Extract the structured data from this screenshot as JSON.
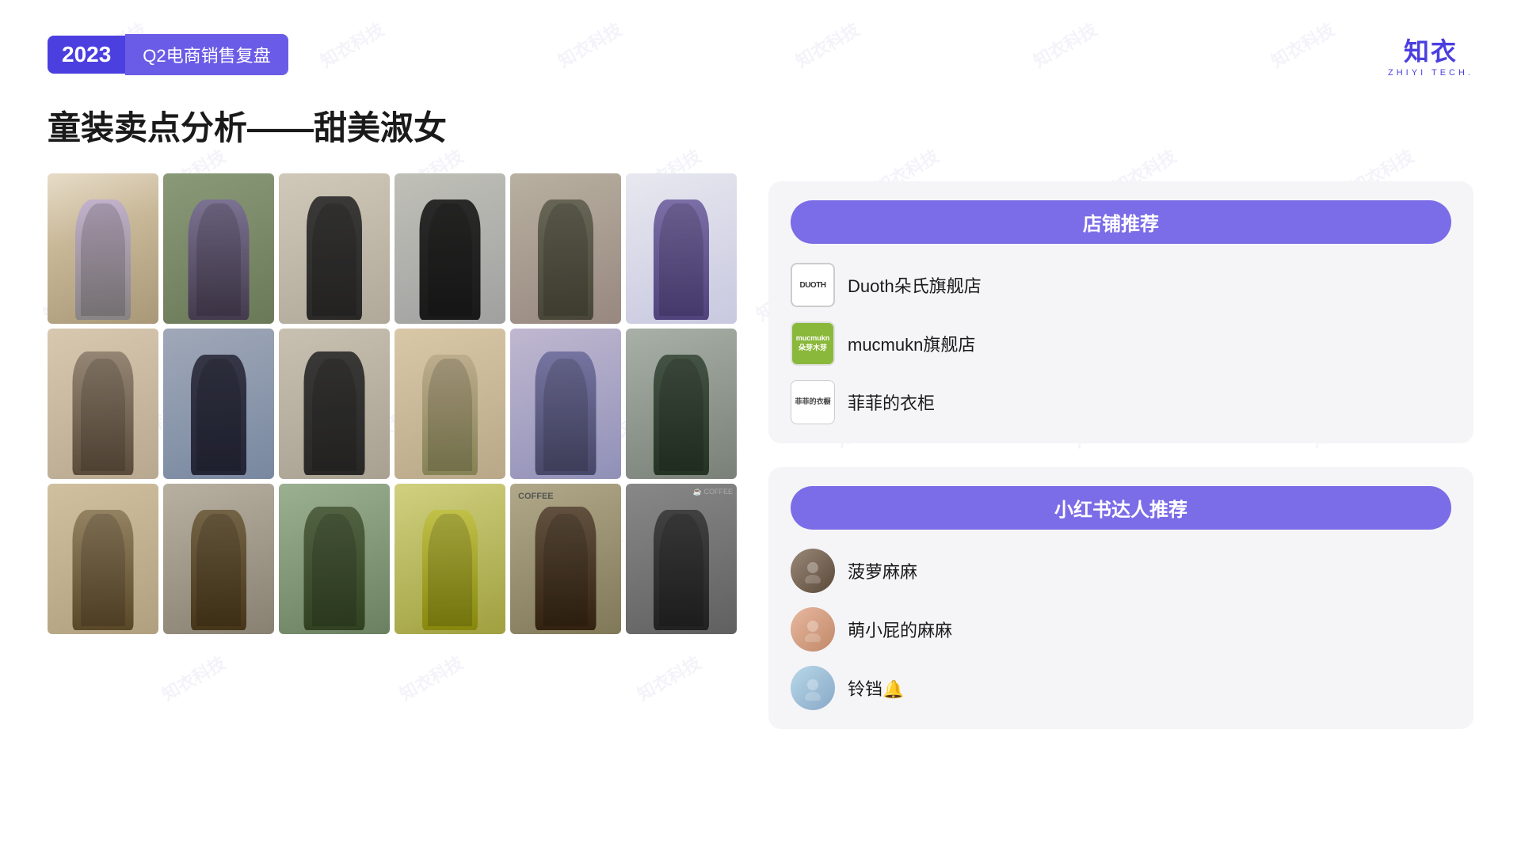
{
  "header": {
    "year": "2023",
    "quarter": "Q2电商销售复盘",
    "logo_main": "知衣",
    "logo_sub": "ZHIYI TECH."
  },
  "page": {
    "title": "童装卖点分析——甜美淑女"
  },
  "right_panel": {
    "store_section_title": "店铺推荐",
    "stores": [
      {
        "id": "duoth",
        "logo_text": "DUOTH",
        "name": "Duoth朵氏旗舰店"
      },
      {
        "id": "mucmukn",
        "logo_text": "mucmukn 朵芽木芽",
        "name": "mucmukn旗舰店"
      },
      {
        "id": "fifi",
        "logo_text": "菲菲的衣橱",
        "name": "菲菲的衣柜"
      }
    ],
    "influencer_section_title": "小红书达人推荐",
    "influencers": [
      {
        "id": "1",
        "name": "菠萝麻麻"
      },
      {
        "id": "2",
        "name": "萌小屁的麻麻"
      },
      {
        "id": "3",
        "name": "铃铛🔔"
      }
    ]
  },
  "watermark": {
    "text": "知衣科技"
  },
  "grid": {
    "cells": 18,
    "coffee_label": "COFFEE"
  }
}
